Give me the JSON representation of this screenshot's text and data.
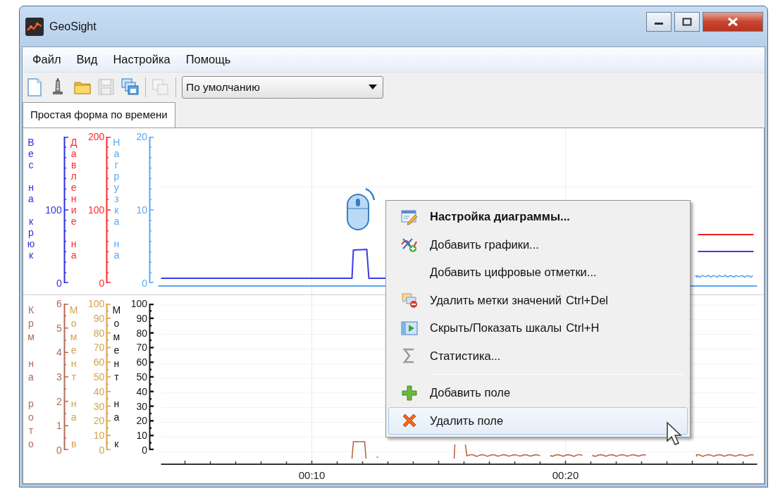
{
  "window": {
    "title": "GeoSight"
  },
  "menu_bar": [
    "Файл",
    "Вид",
    "Настройка",
    "Помощь"
  ],
  "toolbar": {
    "groups": [
      [
        {
          "disabled": false
        },
        {
          "disabled": false
        },
        {
          "disabled": false
        },
        {
          "disabled": true
        },
        {
          "disabled": false
        }
      ],
      [
        {
          "disabled": true
        }
      ]
    ],
    "preset": {
      "value": "По умолчанию"
    }
  },
  "tabs": [
    {
      "label": "Простая форма по времени",
      "selected": true
    }
  ],
  "panes": [
    {
      "axes": [
        {
          "title": "Вес на крюк",
          "color": "#3030dd",
          "ticks": [
            "100",
            "0"
          ]
        },
        {
          "title": "Давление на",
          "color": "#ff2a2a",
          "ticks": [
            "200",
            "100",
            "0"
          ]
        },
        {
          "title": "Нагрузка на",
          "color": "#58a8f5",
          "ticks": [
            "20",
            "10",
            "0"
          ]
        }
      ]
    },
    {
      "axes": [
        {
          "title": "Крм на рото",
          "color": "#b06a55",
          "ticks": [
            "6",
            "5",
            "4",
            "3",
            "2",
            "1",
            "0"
          ]
        },
        {
          "title": "Момент на в",
          "color": "#d4a24c",
          "ticks": [
            "100",
            "90",
            "80",
            "70",
            "60",
            "50",
            "40",
            "30",
            "20",
            "10",
            "0"
          ]
        },
        {
          "title": "Момент на к",
          "color": "#151515",
          "ticks": [
            "100",
            "90",
            "80",
            "70",
            "60",
            "50",
            "40",
            "30",
            "20",
            "10",
            "0"
          ]
        }
      ]
    }
  ],
  "time_axis": {
    "labels": [
      "00:10",
      "00:20"
    ]
  },
  "context_menu": {
    "items": [
      {
        "kind": "item",
        "label": "Настройка диаграммы...",
        "default": true,
        "selected": false
      },
      {
        "kind": "item",
        "label": "Добавить графики...",
        "default": false,
        "selected": false
      },
      {
        "kind": "item",
        "label": "Добавить цифровые отметки...",
        "default": false,
        "selected": false
      },
      {
        "kind": "item",
        "label": "Удалить метки значений",
        "shortcut": "Ctrl+Del",
        "default": false,
        "selected": false
      },
      {
        "kind": "item",
        "label": "Скрыть/Показать шкалы",
        "shortcut": "Ctrl+H",
        "default": false,
        "selected": false
      },
      {
        "kind": "item",
        "label": "Статистика...",
        "default": false,
        "selected": false
      },
      {
        "kind": "separator"
      },
      {
        "kind": "item",
        "label": "Добавить поле",
        "default": false,
        "selected": false
      },
      {
        "kind": "item",
        "label": "Удалить поле",
        "default": false,
        "selected": true
      }
    ]
  }
}
